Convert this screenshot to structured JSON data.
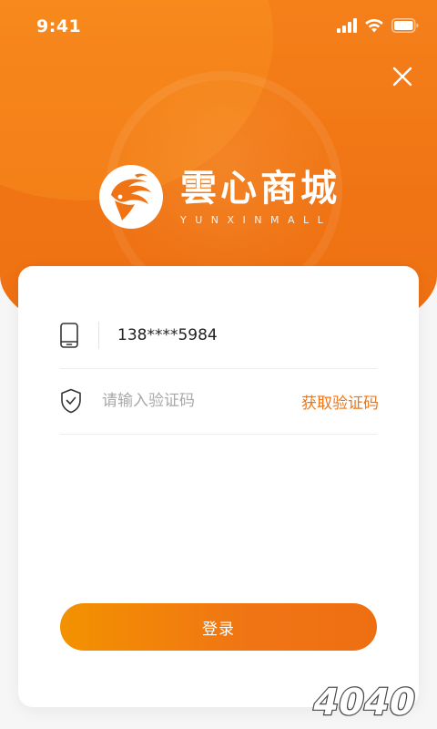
{
  "status_bar": {
    "time": "9:41"
  },
  "brand": {
    "name": "雲心商城",
    "subtitle": "YUNXINMALL"
  },
  "form": {
    "phone_value": "138****5984",
    "code_placeholder": "请输入验证码",
    "get_code_label": "获取验证码",
    "login_label": "登录"
  },
  "icons": {
    "close": "close-icon",
    "phone": "phone-icon",
    "shield": "shield-check-icon",
    "signal": "signal-icon",
    "wifi": "wifi-icon",
    "battery": "battery-icon"
  },
  "colors": {
    "brand_orange": "#f07414",
    "gradient_start": "#f39200",
    "background": "#f6f6f6"
  },
  "watermark": {
    "text": "4040"
  }
}
